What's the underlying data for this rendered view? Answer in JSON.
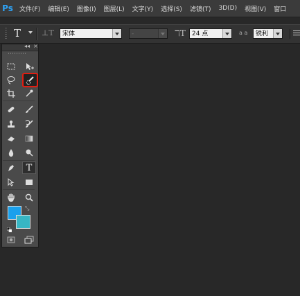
{
  "app": {
    "logo": "Ps"
  },
  "menu": {
    "items": [
      "文件(F)",
      "编辑(E)",
      "图像(I)",
      "图层(L)",
      "文字(Y)",
      "选择(S)",
      "滤镜(T)",
      "3D(D)",
      "视图(V)",
      "窗口"
    ]
  },
  "options_bar": {
    "tool_glyph": "T",
    "font_family": "宋体",
    "font_style": "-",
    "font_size": "24 点",
    "aa_label": "a a",
    "antialias": "锐利"
  },
  "toolbox": {
    "collapse_label": "◂◂",
    "close_label": "×",
    "text_tool_glyph": "T",
    "selected_tool": "quick-selection-tool",
    "foreground_color": "#1aa0ec",
    "background_color": "#37b6c4",
    "tools": [
      "rectangular-marquee-tool",
      "move-tool",
      "lasso-tool",
      "quick-selection-tool",
      "crop-tool",
      "eyedropper-tool",
      "spot-healing-brush-tool",
      "brush-tool",
      "clone-stamp-tool",
      "history-brush-tool",
      "eraser-tool",
      "gradient-tool",
      "blur-tool",
      "dodge-tool",
      "pen-tool",
      "horizontal-type-tool",
      "path-selection-tool",
      "rectangle-tool",
      "hand-tool",
      "zoom-tool",
      "quick-mask-mode",
      "screen-mode"
    ]
  }
}
